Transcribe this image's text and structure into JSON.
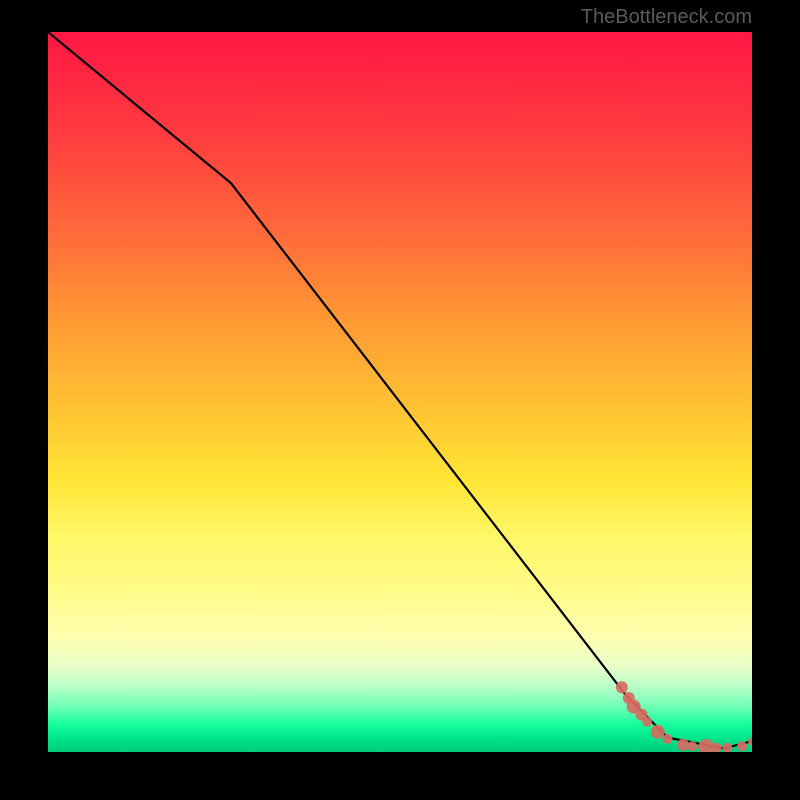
{
  "watermark_text": "TheBottleneck.com",
  "chart_data": {
    "type": "line",
    "title": "",
    "xlabel": "",
    "ylabel": "",
    "xlim": [
      0,
      100
    ],
    "ylim": [
      0,
      100
    ],
    "series": [
      {
        "name": "curve",
        "color": "#000000",
        "x": [
          0,
          26,
          82,
          88,
          96,
          100
        ],
        "y": [
          100,
          79,
          8,
          2,
          0.5,
          1.5
        ]
      }
    ],
    "scatter": {
      "name": "points",
      "color": "#d86a62",
      "x": [
        81.5,
        82.5,
        83.2,
        84.3,
        85.1,
        86.6,
        88.0,
        90.2,
        91.5,
        93.5,
        95.0,
        96.5,
        98.6,
        100
      ],
      "y": [
        9.0,
        7.5,
        6.3,
        5.2,
        4.2,
        2.8,
        1.8,
        1.0,
        0.8,
        0.7,
        0.6,
        0.6,
        0.8,
        1.5
      ],
      "sizes": [
        12,
        12,
        14,
        12,
        10,
        14,
        10,
        12,
        10,
        16,
        10,
        10,
        10,
        8
      ]
    },
    "gradient_stops": [
      {
        "pos": 0.0,
        "color": "#ff1744"
      },
      {
        "pos": 0.5,
        "color": "#ffd633"
      },
      {
        "pos": 0.85,
        "color": "#ffffb0"
      },
      {
        "pos": 1.0,
        "color": "#00cc7a"
      }
    ]
  }
}
